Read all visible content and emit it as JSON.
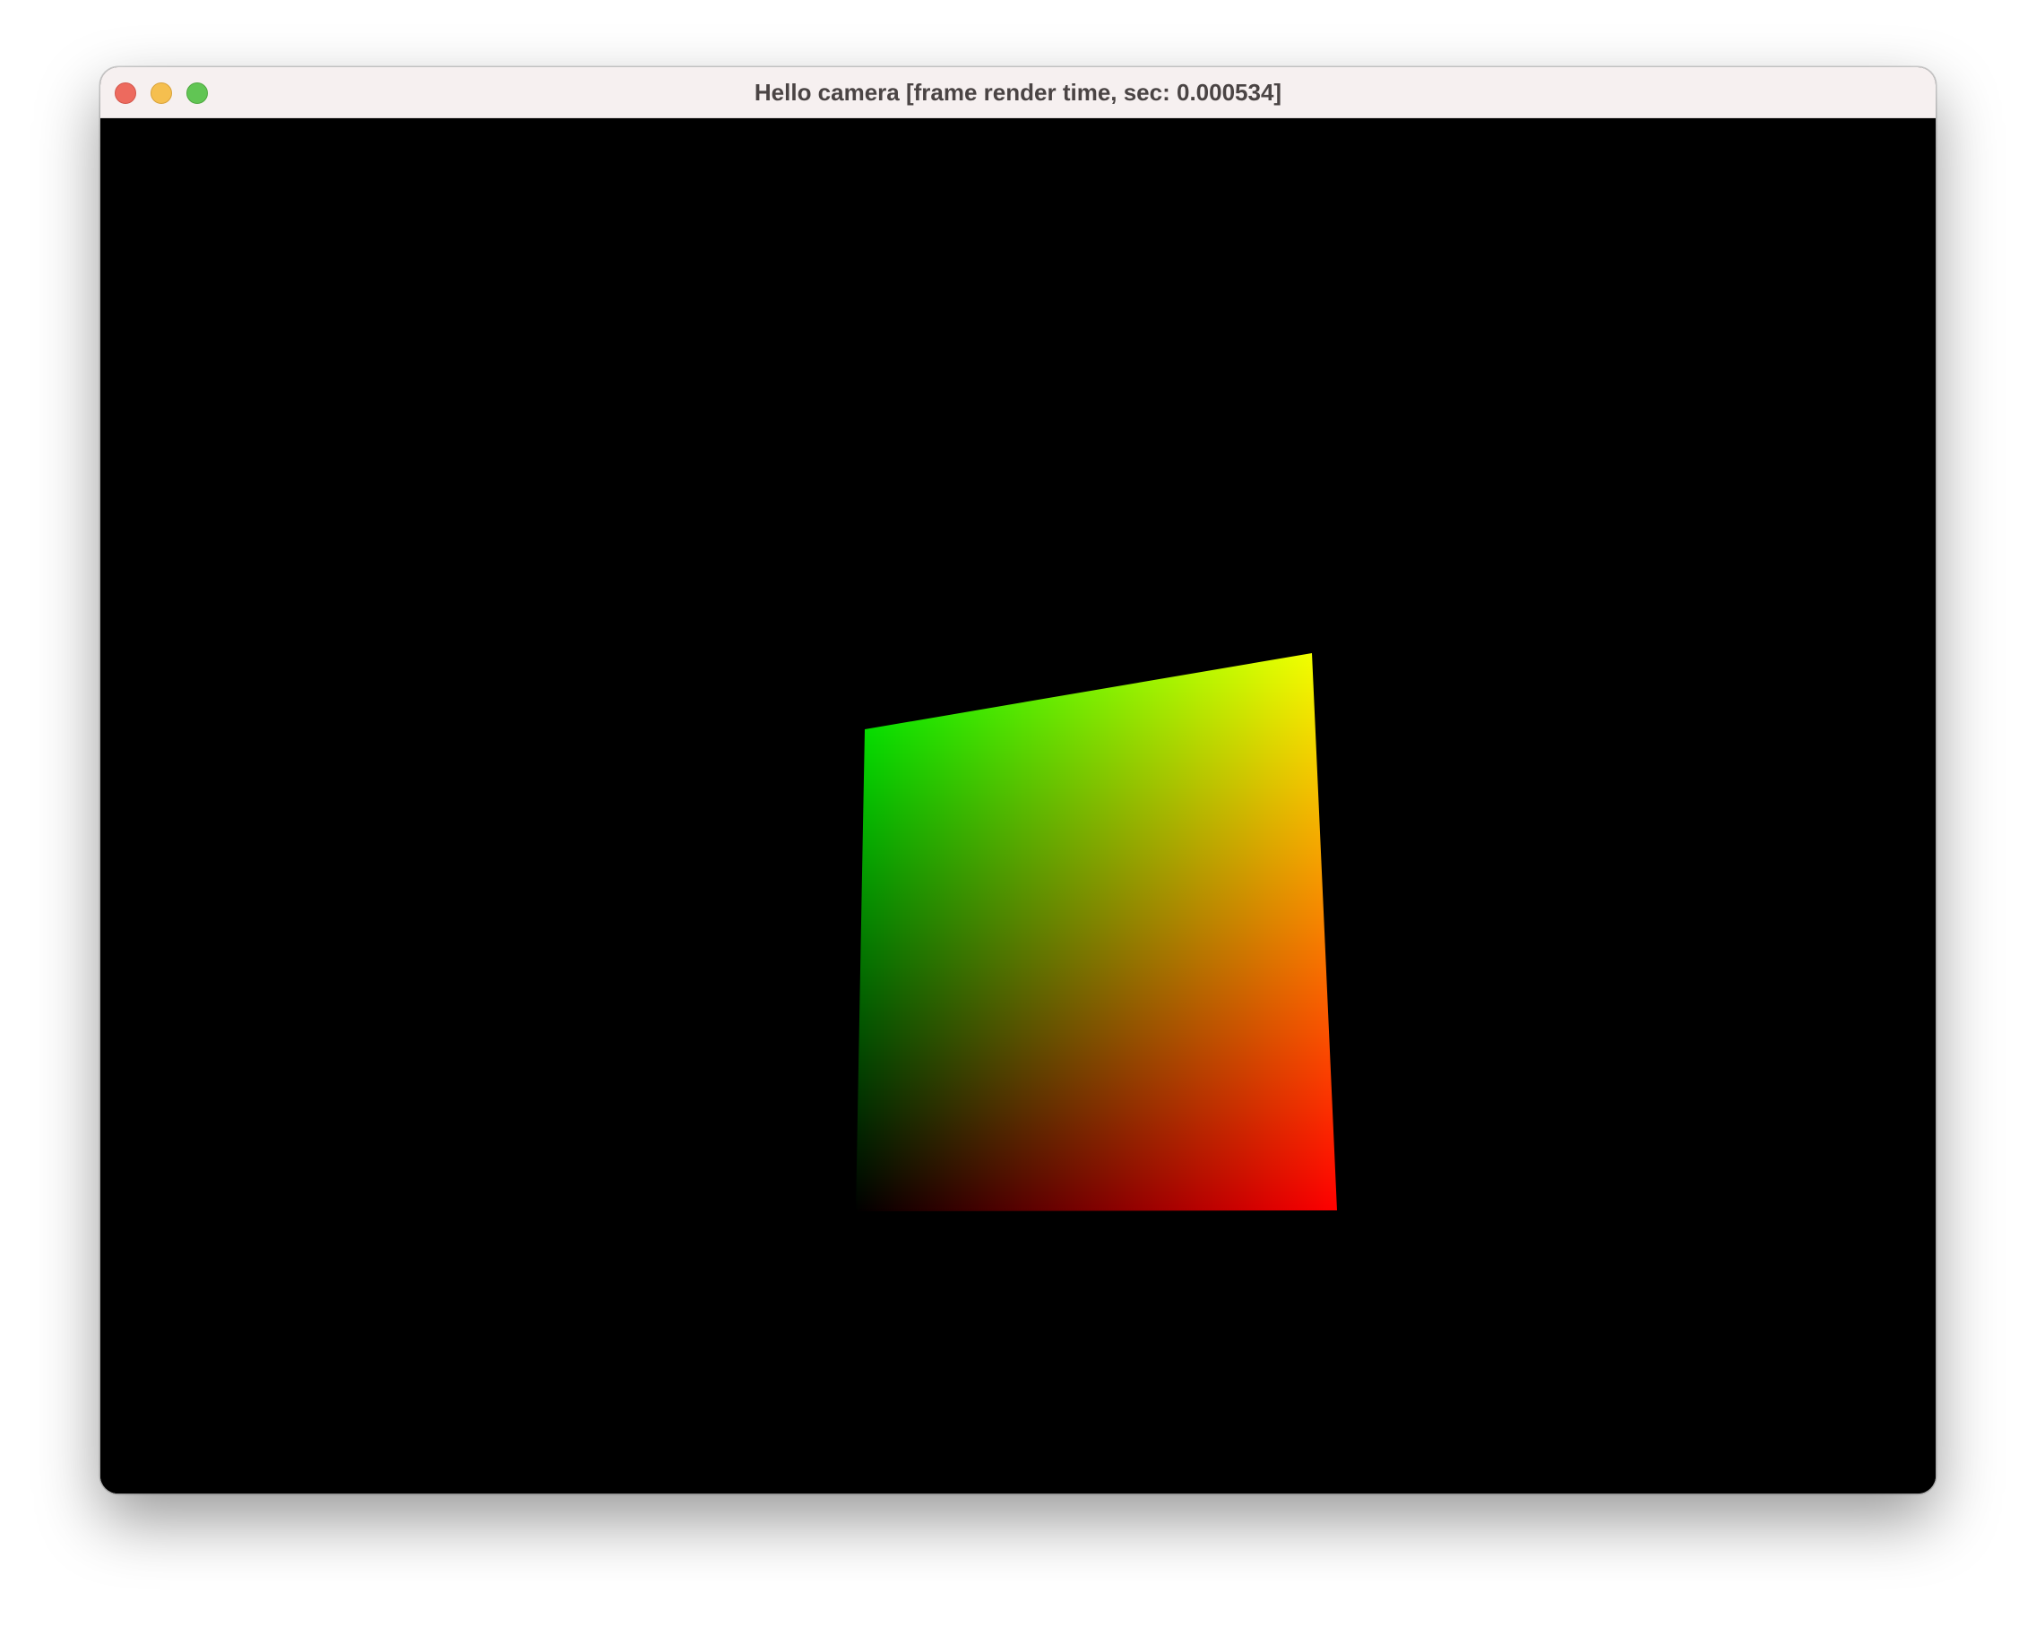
{
  "window": {
    "title": "Hello camera [frame render time, sec: 0.000534]",
    "controls": {
      "close_color": "#ed6a5e",
      "minimize_color": "#f5bf4f",
      "zoom_color": "#61c554"
    }
  },
  "scene": {
    "background_color": "#000000",
    "quad_corner_colors": {
      "top_left": "#00ff00",
      "top_right": "#ffff00",
      "bottom_right": "#ff0000",
      "bottom_left": "#000000"
    }
  }
}
